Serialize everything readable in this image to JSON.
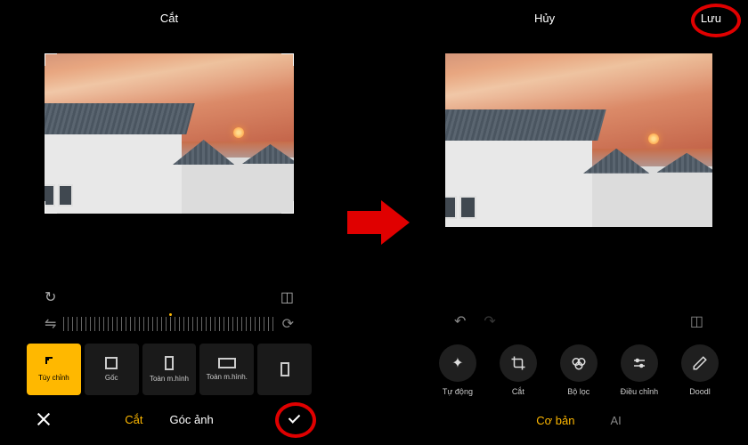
{
  "left": {
    "title": "Cắt",
    "aspect_options": [
      {
        "label": "Tùy chỉnh",
        "active": true
      },
      {
        "label": "Gốc",
        "shape": "sq"
      },
      {
        "label": "Toàn m.hình",
        "shape": "pt"
      },
      {
        "label": "Toàn m.hình.",
        "shape": "ls"
      },
      {
        "label": ""
      }
    ],
    "bottom_tabs": [
      "Cắt",
      "Góc ảnh"
    ]
  },
  "right": {
    "cancel": "Hủy",
    "save": "Lưu",
    "tools": [
      {
        "label": "Tự động",
        "icon": "✦"
      },
      {
        "label": "Cắt",
        "icon": "crop"
      },
      {
        "label": "Bộ lọc",
        "icon": "filter"
      },
      {
        "label": "Điều chỉnh",
        "icon": "adjust"
      },
      {
        "label": "Doodl",
        "icon": "pencil"
      }
    ],
    "tabs": [
      "Cơ bản",
      "AI"
    ]
  },
  "icons": {
    "rotate": "↻",
    "flip": "⇋",
    "aspect": "◫",
    "straighten": "⟳",
    "undo": "↶",
    "redo": "↷",
    "compare": "◫"
  }
}
